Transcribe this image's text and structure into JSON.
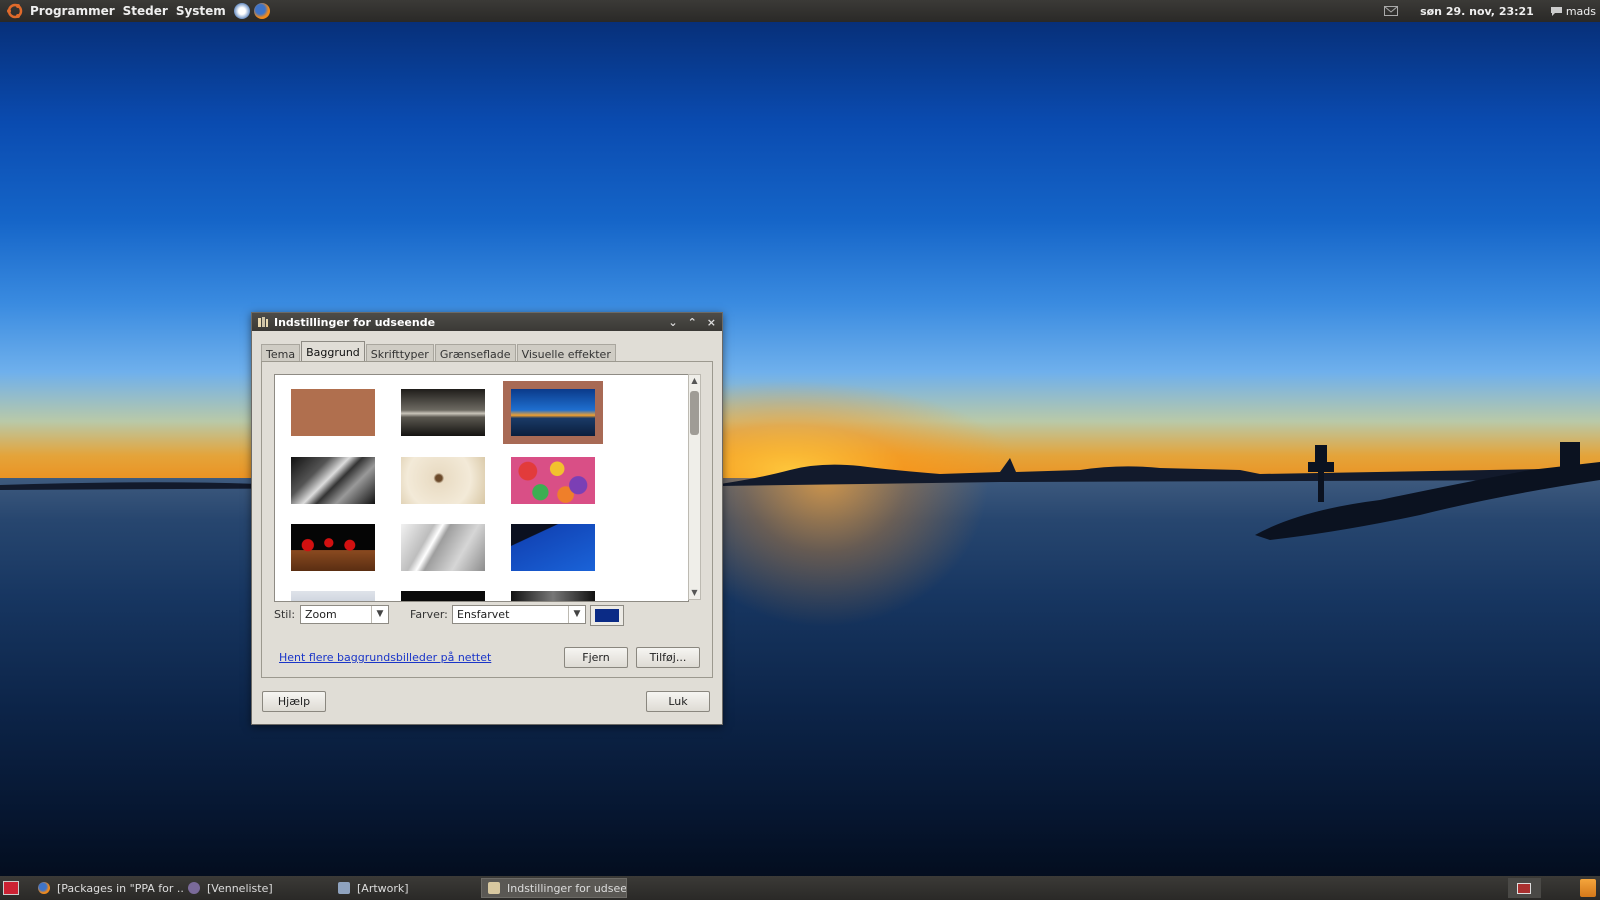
{
  "top_panel": {
    "menus": [
      "Programmer",
      "Steder",
      "System"
    ],
    "clock": "søn 29. nov, 23:21",
    "user": "mads"
  },
  "window": {
    "title": "Indstillinger for udseende",
    "controls": {
      "minimize": "⌄",
      "maximize": "⌃",
      "close": "×"
    },
    "tabs": [
      "Tema",
      "Baggrund",
      "Skrifttyper",
      "Grænseflade",
      "Visuelle effekter"
    ],
    "active_tab": "Baggrund",
    "style_label": "Stil:",
    "style_value": "Zoom",
    "colors_label": "Farver:",
    "colors_value": "Ensfarvet",
    "swatch_color": "#0b2b86",
    "more_link": "Hent flere baggrundsbilleder på nettet",
    "remove_button": "Fjern",
    "add_button": "Tilføj...",
    "help_button": "Hjælp",
    "close_button": "Luk",
    "wallpapers": [
      {
        "name": "solid-brown",
        "selected": false
      },
      {
        "name": "dark-clouds",
        "selected": false
      },
      {
        "name": "blue-sunset-sea",
        "selected": true
      },
      {
        "name": "vintage-car",
        "selected": false
      },
      {
        "name": "butterfly-field",
        "selected": false
      },
      {
        "name": "colorful-buttons",
        "selected": false
      },
      {
        "name": "red-cherries",
        "selected": false
      },
      {
        "name": "silver-abstract",
        "selected": false
      },
      {
        "name": "blue-silhouette",
        "selected": false
      }
    ]
  },
  "taskbar": {
    "tasks": [
      {
        "label": "[Packages in \"PPA for ...",
        "icon": "firefox-icon"
      },
      {
        "label": "[Venneliste]",
        "icon": "pidgin-icon"
      },
      {
        "label": "[Artwork]",
        "icon": "chat-icon"
      },
      {
        "label": "Indstillinger for udsee...",
        "icon": "appearance-icon",
        "active": true
      }
    ]
  }
}
